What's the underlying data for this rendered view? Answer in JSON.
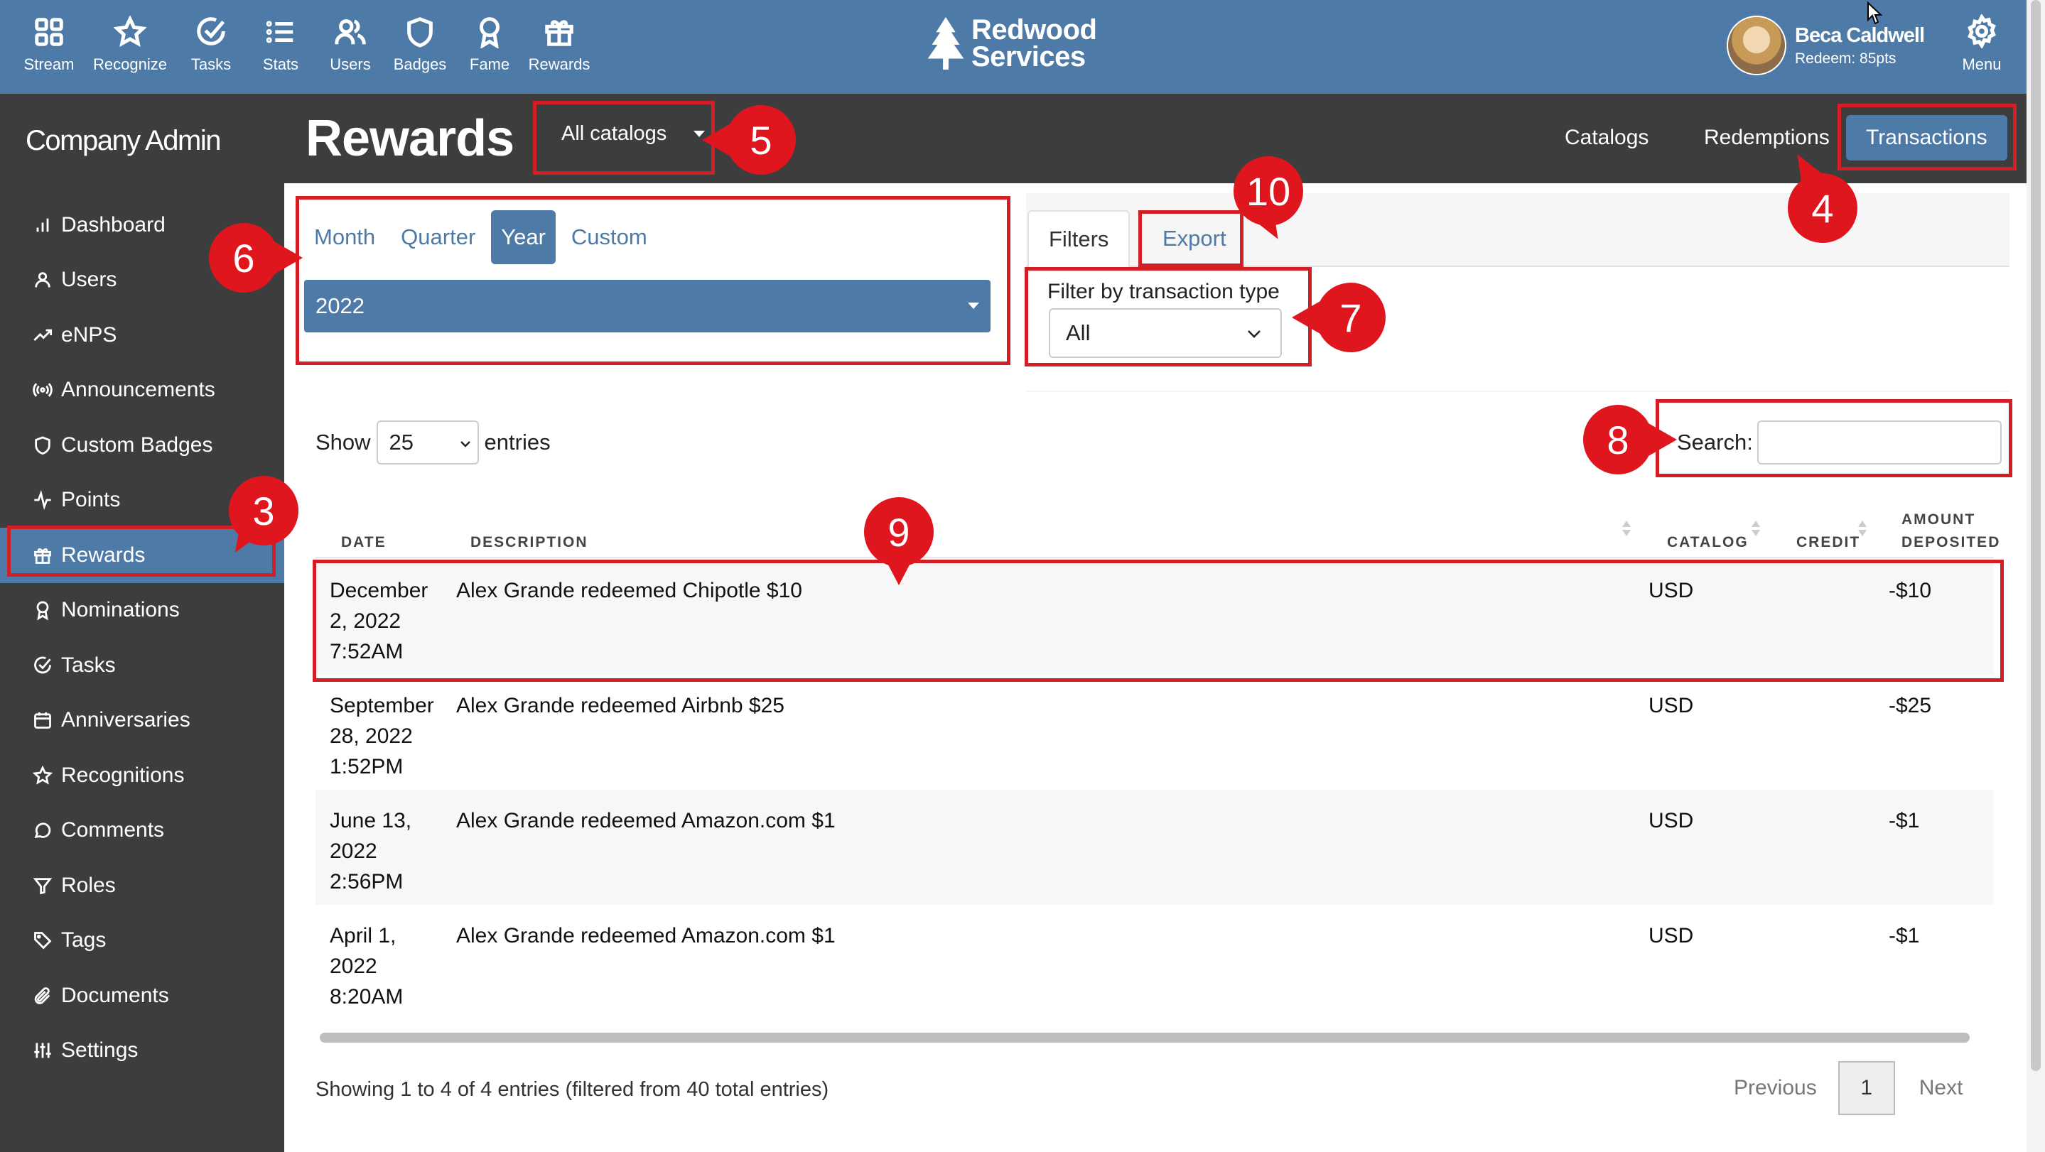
{
  "topnav": {
    "items": [
      {
        "label": "Stream",
        "icon": "grid-icon"
      },
      {
        "label": "Recognize",
        "icon": "star-icon"
      },
      {
        "label": "Tasks",
        "icon": "check-circle-icon"
      },
      {
        "label": "Stats",
        "icon": "list-icon"
      },
      {
        "label": "Users",
        "icon": "users-icon"
      },
      {
        "label": "Badges",
        "icon": "shield-icon"
      },
      {
        "label": "Fame",
        "icon": "award-icon"
      },
      {
        "label": "Rewards",
        "icon": "gift-icon"
      }
    ],
    "brand_line1": "Redwood",
    "brand_line2": "Services",
    "user_name": "Beca Caldwell",
    "user_sub": "Redeem: 85pts",
    "menu_label": "Menu"
  },
  "sidebar": {
    "title": "Company Admin",
    "items": [
      {
        "label": "Dashboard",
        "icon": "bar-chart-icon"
      },
      {
        "label": "Users",
        "icon": "user-icon"
      },
      {
        "label": "eNPS",
        "icon": "trend-icon"
      },
      {
        "label": "Announcements",
        "icon": "broadcast-icon"
      },
      {
        "label": "Custom Badges",
        "icon": "shield-icon"
      },
      {
        "label": "Points",
        "icon": "activity-icon"
      },
      {
        "label": "Rewards",
        "icon": "gift-icon"
      },
      {
        "label": "Nominations",
        "icon": "award-icon"
      },
      {
        "label": "Tasks",
        "icon": "check-circle-icon"
      },
      {
        "label": "Anniversaries",
        "icon": "calendar-icon"
      },
      {
        "label": "Recognitions",
        "icon": "star-icon"
      },
      {
        "label": "Comments",
        "icon": "comment-icon"
      },
      {
        "label": "Roles",
        "icon": "filter-icon"
      },
      {
        "label": "Tags",
        "icon": "tag-icon"
      },
      {
        "label": "Documents",
        "icon": "paperclip-icon"
      },
      {
        "label": "Settings",
        "icon": "sliders-icon"
      }
    ],
    "active_index": 6
  },
  "header": {
    "title": "Rewards",
    "catalog_select": "All catalogs",
    "tabs": [
      "Catalogs",
      "Redemptions",
      "Transactions"
    ],
    "active_tab": "Transactions"
  },
  "period": {
    "tabs": [
      "Month",
      "Quarter",
      "Year",
      "Custom"
    ],
    "active_tab": "Year",
    "year_value": "2022"
  },
  "filters": {
    "tab_filters": "Filters",
    "tab_export": "Export",
    "type_label": "Filter by transaction type",
    "type_value": "All"
  },
  "table_controls": {
    "show_label": "Show",
    "entries_value": "25",
    "entries_label": "entries",
    "search_label": "Search:",
    "search_value": ""
  },
  "table": {
    "columns": [
      "DATE",
      "DESCRIPTION",
      "CATALOG",
      "CREDIT",
      "AMOUNT",
      "DEPOSITED"
    ],
    "rows": [
      {
        "date_1": "December",
        "date_2": "2, 2022",
        "date_3": "7:52AM",
        "description": "Alex Grande redeemed Chipotle $10",
        "catalog": "USD",
        "credit": "",
        "amount": "-$10"
      },
      {
        "date_1": "September",
        "date_2": "28, 2022",
        "date_3": "1:52PM",
        "description": "Alex Grande redeemed Airbnb $25",
        "catalog": "USD",
        "credit": "",
        "amount": "-$25"
      },
      {
        "date_1": "June 13,",
        "date_2": "2022",
        "date_3": "2:56PM",
        "description": "Alex Grande redeemed Amazon.com $1",
        "catalog": "USD",
        "credit": "",
        "amount": "-$1"
      },
      {
        "date_1": "April 1,",
        "date_2": "2022",
        "date_3": "8:20AM",
        "description": "Alex Grande redeemed Amazon.com $1",
        "catalog": "USD",
        "credit": "",
        "amount": "-$1"
      }
    ]
  },
  "footer": {
    "showing": "Showing 1 to 4 of 4 entries (filtered from 40 total entries)",
    "previous": "Previous",
    "page": "1",
    "next": "Next"
  },
  "annotations": [
    "3",
    "4",
    "5",
    "6",
    "7",
    "8",
    "9",
    "10"
  ],
  "colors": {
    "primary": "#4e7aa7",
    "dark": "#3d3d3d",
    "highlight": "#d21f26",
    "callout": "#e0161f"
  }
}
